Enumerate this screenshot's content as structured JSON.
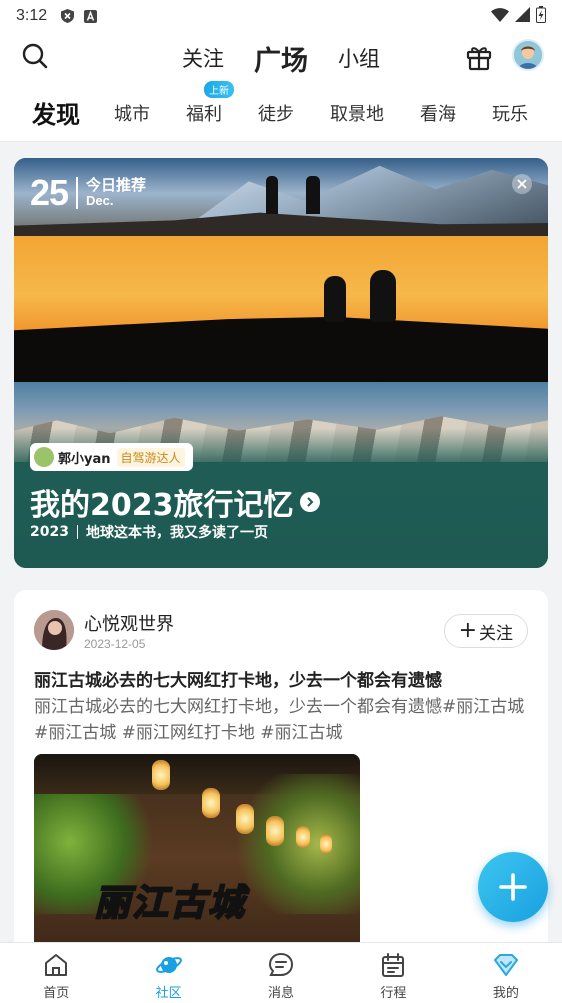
{
  "status_bar": {
    "time": "3:12",
    "icons": [
      "shield-x-icon",
      "font-a-icon",
      "wifi-icon",
      "signal-icon",
      "battery-icon"
    ]
  },
  "header": {
    "tabs": [
      {
        "label": "关注",
        "active": false
      },
      {
        "label": "广场",
        "active": true
      },
      {
        "label": "小组",
        "active": false
      }
    ],
    "icons": [
      "search-icon",
      "gift-icon",
      "avatar"
    ]
  },
  "categories": {
    "items": [
      {
        "label": "发现",
        "active": true
      },
      {
        "label": "城市"
      },
      {
        "label": "福利",
        "badge": "上新"
      },
      {
        "label": "徒步"
      },
      {
        "label": "取景地"
      },
      {
        "label": "看海"
      },
      {
        "label": "玩乐"
      }
    ]
  },
  "banner": {
    "day": "25",
    "recommend": "今日推荐",
    "month": "Dec.",
    "author_name": "郭小yan",
    "author_tag": "自驾游达人",
    "title": "我的2023旅行记忆",
    "subtitle_year": "2023",
    "subtitle_text": "地球这本书，我又多读了一页"
  },
  "post": {
    "username": "心悦观世界",
    "date": "2023-12-05",
    "follow_label": "关注",
    "title": "丽江古城必去的七大网红打卡地，少去一个都会有遗憾",
    "body": "丽江古城必去的七大网红打卡地，少去一个都会有遗憾#丽江古城 #丽江古城 #丽江网红打卡地 #丽江古城",
    "image_text": "丽江古城"
  },
  "bottom_nav": {
    "items": [
      {
        "label": "首页",
        "icon": "home-icon"
      },
      {
        "label": "社区",
        "icon": "planet-icon",
        "active": true
      },
      {
        "label": "消息",
        "icon": "message-icon"
      },
      {
        "label": "行程",
        "icon": "calendar-icon"
      },
      {
        "label": "我的",
        "icon": "diamond-icon"
      }
    ]
  },
  "colors": {
    "accent": "#1aa0e0",
    "banner_bg": "#1e5a52"
  }
}
